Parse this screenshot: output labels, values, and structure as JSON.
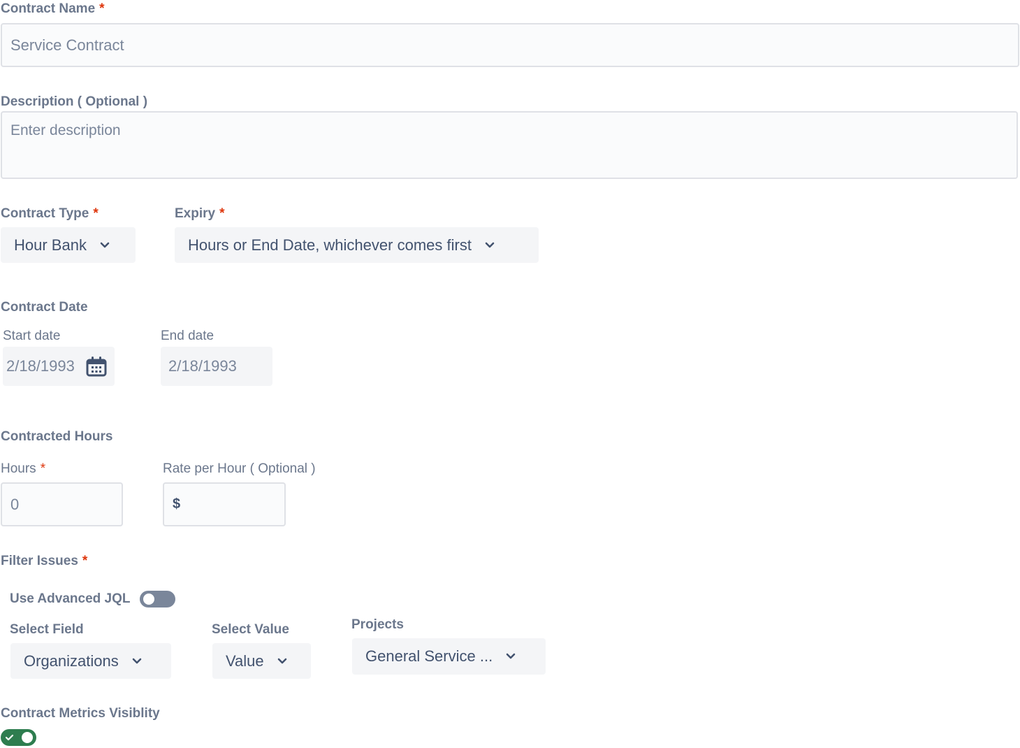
{
  "contract_name": {
    "label": "Contract Name",
    "required_mark": "*",
    "value": "Service Contract"
  },
  "description": {
    "label": "Description ( Optional )",
    "placeholder": "Enter description"
  },
  "contract_type": {
    "label": "Contract Type",
    "required_mark": "*",
    "selected": "Hour Bank"
  },
  "expiry": {
    "label": "Expiry",
    "required_mark": "*",
    "selected": "Hours or End Date, whichever comes first"
  },
  "contract_date": {
    "label": "Contract Date",
    "start_label": "Start date",
    "start_value": "2/18/1993",
    "end_label": "End date",
    "end_value": "2/18/1993"
  },
  "contracted_hours": {
    "label": "Contracted Hours",
    "hours_label": "Hours",
    "required_mark": "*",
    "hours_value": "0",
    "rate_label": "Rate per Hour ( Optional )",
    "rate_prefix": "$"
  },
  "filter_issues": {
    "label": "Filter Issues",
    "required_mark": "*",
    "advanced_jql_label": "Use Advanced JQL",
    "advanced_jql_on": false,
    "select_field_label": "Select Field",
    "select_field_value": "Organizations",
    "select_value_label": "Select Value",
    "select_value_value": "Value",
    "projects_label": "Projects",
    "projects_value": "General Service ..."
  },
  "metrics_visibility": {
    "label": "Contract Metrics Visiblity",
    "on": true
  },
  "colors": {
    "required": "#de350b",
    "toggle_on": "#2e7d4f",
    "toggle_off": "#7a869a",
    "calendar_icon": "#42526e"
  },
  "icons": {
    "dropdown": "chevron-down-icon",
    "date": "calendar-icon",
    "toggle_on": "check-icon"
  }
}
